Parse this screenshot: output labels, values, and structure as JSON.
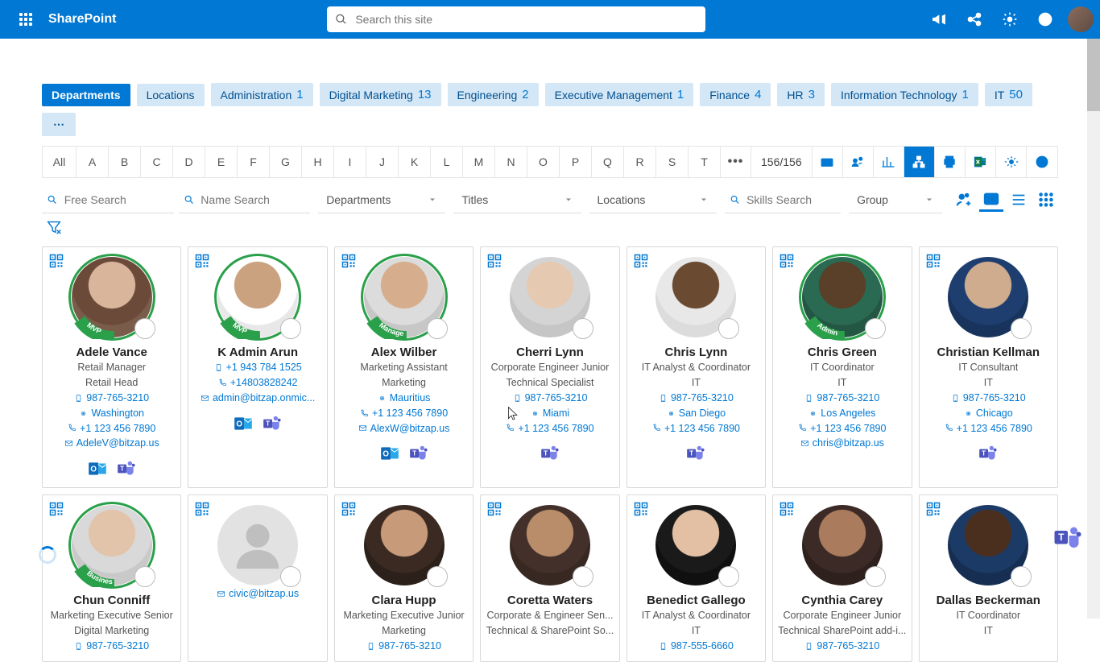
{
  "topbar": {
    "brand": "SharePoint",
    "search_placeholder": "Search this site"
  },
  "tabs": {
    "departments": "Departments",
    "locations": "Locations",
    "items": [
      {
        "label": "Administration",
        "count": "1"
      },
      {
        "label": "Digital Marketing",
        "count": "13"
      },
      {
        "label": "Engineering",
        "count": "2"
      },
      {
        "label": "Executive Management",
        "count": "1"
      },
      {
        "label": "Finance",
        "count": "4"
      },
      {
        "label": "HR",
        "count": "3"
      },
      {
        "label": "Information Technology",
        "count": "1"
      },
      {
        "label": "IT",
        "count": "50"
      }
    ],
    "overflow": "⋯"
  },
  "alpha": {
    "all": "All",
    "letters": [
      "A",
      "B",
      "C",
      "D",
      "E",
      "F",
      "G",
      "H",
      "I",
      "J",
      "K",
      "L",
      "M",
      "N",
      "O",
      "P",
      "Q",
      "R",
      "S",
      "T"
    ],
    "more": "•••",
    "count": "156/156"
  },
  "filters": {
    "free_search": "Free Search",
    "name_search": "Name Search",
    "departments": "Departments",
    "titles": "Titles",
    "locations": "Locations",
    "skills_search": "Skills Search",
    "group": "Group"
  },
  "toolbar_icons": [
    "inbox-icon",
    "share-icon",
    "chart-icon",
    "org-icon",
    "print-icon",
    "excel-icon",
    "settings-icon",
    "help-icon"
  ],
  "people": [
    {
      "name": "Adele Vance",
      "title": "Retail Manager",
      "dept": "Retail Head",
      "phone": "987-765-3210",
      "location": "Washington",
      "alt_phone": "+1 123 456 7890",
      "email": "AdeleV@bitzap.us",
      "badge": "MVP",
      "ring": "#2aa04a",
      "photo": "ph-1",
      "apps": [
        "outlook",
        "teams"
      ]
    },
    {
      "name": "K Admin Arun",
      "title": "",
      "dept": "",
      "phone": "+1 943 784 1525",
      "location": "",
      "alt_phone": "+14803828242",
      "email": "admin@bitzap.onmic...",
      "badge": "MVP",
      "ring": "#2aa04a",
      "photo": "ph-2",
      "apps": [
        "outlook",
        "teams"
      ]
    },
    {
      "name": "Alex Wilber",
      "title": "Marketing Assistant",
      "dept": "Marketing",
      "phone": "",
      "location": "Mauritius",
      "alt_phone": "+1 123 456 7890",
      "email": "AlexW@bitzap.us",
      "badge": "Manager",
      "ring": "#2aa04a",
      "photo": "ph-3",
      "apps": [
        "outlook",
        "teams"
      ]
    },
    {
      "name": "Cherri Lynn",
      "title": "Corporate Engineer Junior",
      "dept": "Technical Specialist",
      "phone": "987-765-3210",
      "location": "Miami",
      "alt_phone": "+1 123 456 7890",
      "email": "",
      "badge": "",
      "ring": "",
      "photo": "ph-4",
      "apps": [
        "teams"
      ]
    },
    {
      "name": "Chris Lynn",
      "title": "IT Analyst & Coordinator",
      "dept": "IT",
      "phone": "987-765-3210",
      "location": "San Diego",
      "alt_phone": "+1 123 456 7890",
      "email": "",
      "badge": "",
      "ring": "",
      "photo": "ph-5",
      "apps": [
        "teams"
      ]
    },
    {
      "name": "Chris Green",
      "title": "IT Coordinator",
      "dept": "IT",
      "phone": "987-765-3210",
      "location": "Los Angeles",
      "alt_phone": "+1 123 456 7890",
      "email": "chris@bitzap.us",
      "badge": "Admin",
      "ring": "#2aa04a",
      "photo": "ph-6",
      "apps": []
    },
    {
      "name": "Christian Kellman",
      "title": "IT Consultant",
      "dept": "IT",
      "phone": "987-765-3210",
      "location": "Chicago",
      "alt_phone": "+1 123 456 7890",
      "email": "",
      "badge": "",
      "ring": "",
      "photo": "ph-7",
      "apps": [
        "teams"
      ]
    },
    {
      "name": "Chun Conniff",
      "title": "Marketing Executive Senior",
      "dept": "Digital Marketing",
      "phone": "987-765-3210",
      "location": "",
      "alt_phone": "",
      "email": "",
      "badge": "Business Head",
      "ring": "#2aa04a",
      "photo": "ph-8",
      "apps": []
    },
    {
      "name": "",
      "title": "",
      "dept": "",
      "phone": "",
      "location": "",
      "alt_phone": "",
      "email": "civic@bitzap.us",
      "badge": "",
      "ring": "",
      "photo": "placeholder",
      "apps": []
    },
    {
      "name": "Clara Hupp",
      "title": "Marketing Executive Junior",
      "dept": "Marketing",
      "phone": "987-765-3210",
      "location": "",
      "alt_phone": "",
      "email": "",
      "badge": "",
      "ring": "",
      "photo": "ph-10",
      "apps": []
    },
    {
      "name": "Coretta Waters",
      "title": "Corporate & Engineer Sen...",
      "dept": "Technical & SharePoint So...",
      "phone": "",
      "location": "",
      "alt_phone": "",
      "email": "",
      "badge": "",
      "ring": "",
      "photo": "ph-11",
      "apps": []
    },
    {
      "name": "Benedict Gallego",
      "title": "IT Analyst & Coordinator",
      "dept": "IT",
      "phone": "987-555-6660",
      "location": "",
      "alt_phone": "",
      "email": "",
      "badge": "",
      "ring": "",
      "photo": "ph-12",
      "apps": []
    },
    {
      "name": "Cynthia Carey",
      "title": "Corporate Engineer Junior",
      "dept": "Technical SharePoint add-i...",
      "phone": "987-765-3210",
      "location": "",
      "alt_phone": "",
      "email": "",
      "badge": "",
      "ring": "",
      "photo": "ph-13",
      "apps": []
    },
    {
      "name": "Dallas Beckerman",
      "title": "IT Coordinator",
      "dept": "IT",
      "phone": "",
      "location": "",
      "alt_phone": "",
      "email": "",
      "badge": "",
      "ring": "",
      "photo": "ph-14",
      "apps": []
    }
  ]
}
